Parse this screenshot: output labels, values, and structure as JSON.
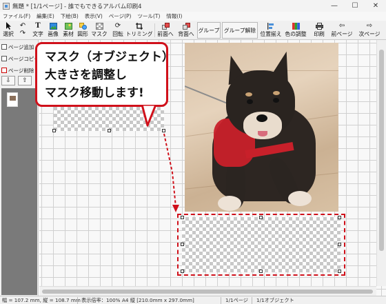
{
  "window": {
    "title": "無題 * [1/1ページ] - 誰でもできるアルバム印刷4",
    "minimize": "—",
    "maximize": "☐",
    "close": "✕"
  },
  "menu": [
    "ファイル(F)",
    "編集(E)",
    "下絵(B)",
    "表示(V)",
    "ページ(P)",
    "ツール(T)",
    "情報(I)"
  ],
  "toolbar": {
    "select": {
      "label": "選択",
      "icon": "cursor-icon"
    },
    "undo": {
      "label": "",
      "icon": "undo-icon"
    },
    "redo": {
      "label": "",
      "icon": "redo-icon"
    },
    "text": {
      "label": "文字",
      "icon": "text-icon"
    },
    "image": {
      "label": "画像",
      "icon": "image-icon"
    },
    "material": {
      "label": "素材",
      "icon": "material-icon"
    },
    "shape": {
      "label": "図形",
      "icon": "shape-icon"
    },
    "mask": {
      "label": "マスク",
      "icon": "mask-icon"
    },
    "rotate": {
      "label": "回転",
      "icon": "rotate-icon"
    },
    "trim": {
      "label": "トリミング",
      "icon": "crop-icon"
    },
    "front": {
      "label": "前面へ",
      "icon": "bring-front-icon"
    },
    "back": {
      "label": "背面へ",
      "icon": "send-back-icon"
    },
    "group": {
      "label": "グループ"
    },
    "ungroup": {
      "label": "グループ解除"
    },
    "align": {
      "label": "位置揃え",
      "icon": "align-icon"
    },
    "color": {
      "label": "色の調整",
      "icon": "color-adjust-icon"
    },
    "print": {
      "label": "印刷",
      "icon": "print-icon"
    },
    "prev": {
      "label": "前ページ",
      "icon": "prev-arrow-icon"
    },
    "next": {
      "label": "次ページ",
      "icon": "next-arrow-icon"
    }
  },
  "sidebar": {
    "add_page": "ページ追加",
    "copy_page": "ページコピー",
    "delete_page": "ページ削除",
    "down": "⇩",
    "up": "⇧"
  },
  "callout": {
    "line1": "マスク（オブジェクト）",
    "line2": "大きさを調整し",
    "line3": "マスク移動します!"
  },
  "status": {
    "size": "幅 = 107.2 mm, 縦 = 108.7 mm",
    "zoom": "表示倍率：100%",
    "paper": "A4 縦 [210.0mm x 297.0mm]",
    "page": "1/1ページ",
    "object": "1/1オブジェクト"
  },
  "colors": {
    "accent": "#d0101a",
    "group_button_bg": "#f6f6f6",
    "thumbnail_panel": "#7a7a7a"
  }
}
